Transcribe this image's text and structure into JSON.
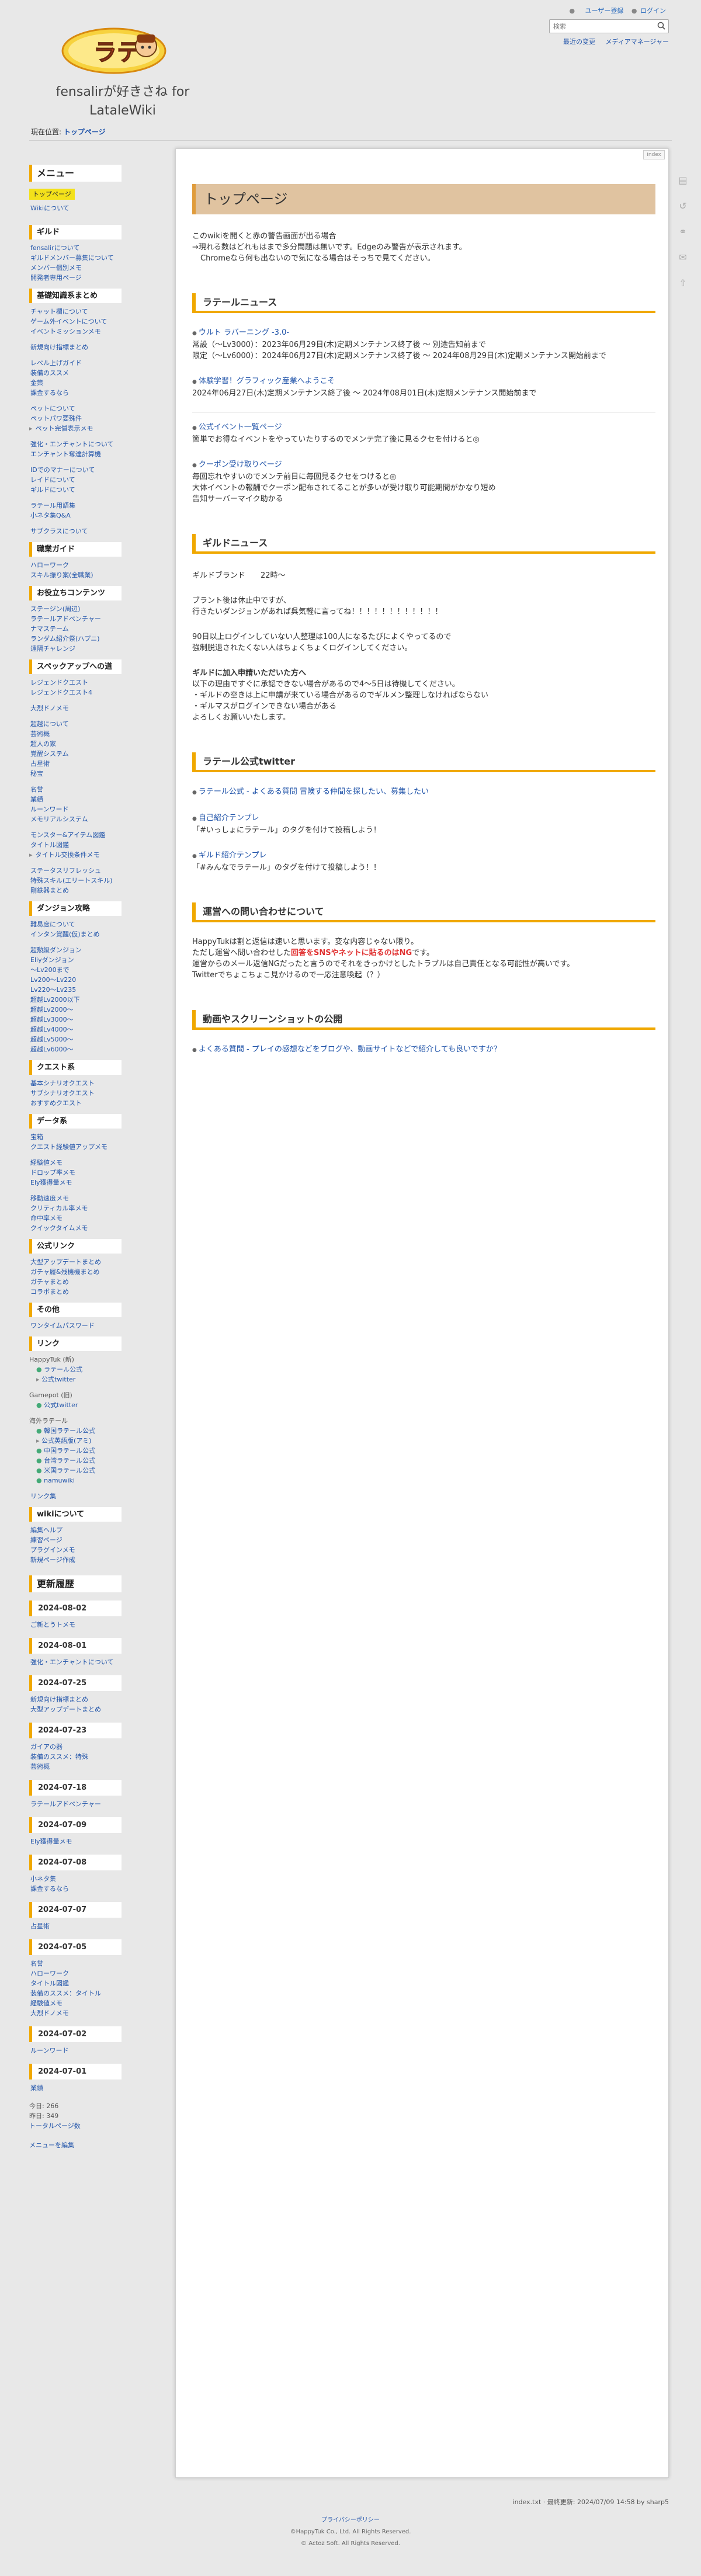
{
  "header": {
    "logo_text": "ラテール",
    "site_title": "fensalirが好きさね for LataleWiki",
    "user_links": [
      "ユーザー登録",
      "ログイン"
    ],
    "search_placeholder": "検索",
    "sub_links": [
      "最近の変更",
      "メディアマネージャー"
    ]
  },
  "breadcrumb": {
    "prefix": "現在位置:",
    "current": "トップページ"
  },
  "sidebar": {
    "menu_title": "メニュー",
    "menu_items": [
      "トップページ",
      "Wikiについて"
    ],
    "guild_title": "ギルド",
    "guild_items": [
      "fensalirについて",
      "ギルドメンバー募集について",
      "メンバー個別メモ",
      "開発者専用ページ"
    ],
    "basic_title": "基礎知識系まとめ",
    "basic_items_1": [
      "チャット欄について",
      "ゲーム外イベントについて",
      "イベントミッションメモ"
    ],
    "basic_items_2": [
      "新規向け指標まとめ"
    ],
    "basic_items_3": [
      "レベル上げガイド",
      "装備のススメ",
      "金策",
      "課金するなら"
    ],
    "basic_items_4": [
      "ペットについて",
      "ペットパワ要殊件",
      "ペット完償表示メモ"
    ],
    "basic_items_5": [
      "強化・エンチャントについて",
      "エンチャント奪達計算機"
    ],
    "basic_items_6": [
      "IDでのマナーについて",
      "レイドについて",
      "ギルドについて"
    ],
    "basic_items_7": [
      "ラテール用語集",
      "小ネタ集Q&A"
    ],
    "basic_items_8": [
      "サブクラスについて"
    ],
    "job_title": "職業ガイド",
    "job_items": [
      "ハローワーク",
      "スキル振り案(全職業)"
    ],
    "useful_title": "お役立ちコンテンツ",
    "useful_items": [
      "ステージン(周辺)",
      "ラテールアドベンチャー",
      "ナマステーム",
      "ランダム紹介祭(ハプニ)",
      "遠隔チャレンジ"
    ],
    "spec_title": "スペックアップへの道",
    "spec_items_1": [
      "レジェンドクエスト",
      "レジェンドクエスト4"
    ],
    "spec_items_2": [
      "大烈ドノメモ"
    ],
    "spec_items_3": [
      "超越について",
      "芸術概",
      "超人の家",
      "覚醒システム",
      "占星術",
      "秘宝"
    ],
    "spec_items_4": [
      "名誉",
      "業績",
      "ルーンワード",
      "メモリアルシステム"
    ],
    "spec_items_5": [
      "モンスター&アイテム図鑑",
      "タイトル図鑑",
      "タイトル交換条件メモ"
    ],
    "spec_items_6": [
      "ステータスリフレッシュ",
      "特殊スキル(エリートスキル)",
      "剛鉄器まとめ"
    ],
    "dungeon_title": "ダンジョン攻略",
    "dungeon_items_1": [
      "難易度について",
      "インタン覚醒(仮)まとめ"
    ],
    "dungeon_items_2": [
      "超勲級ダンジョン",
      "Eliyダンジョン",
      "〜Lv200まで",
      "Lv200〜Lv220",
      "Lv220〜Lv235",
      "超越Lv2000以下",
      "超越Lv2000〜",
      "超越Lv3000〜",
      "超越Lv4000〜",
      "超越Lv5000〜",
      "超越Lv6000〜"
    ],
    "quest_title": "クエスト系",
    "quest_items": [
      "基本シナリオクエスト",
      "サブシナリオクエスト",
      "おすすめクエスト"
    ],
    "data_title": "データ系",
    "data_items_1": [
      "宝箱",
      "クエスト経験値アップメモ"
    ],
    "data_items_2": [
      "経験値メモ",
      "ドロップ率メモ",
      "Ely獲得量メモ"
    ],
    "data_items_3": [
      "移動速度メモ",
      "クリティカル率メモ",
      "命中率メモ",
      "クイックタイムメモ"
    ],
    "official_title": "公式リンク",
    "official_items": [
      "大型アップデートまとめ",
      "ガチャ履&残機機まとめ",
      "ガチャまとめ",
      "コラボまとめ"
    ],
    "other_title": "その他",
    "other_items": [
      "ワンタイムパスワード"
    ],
    "links_title": "リンク",
    "link_group1": "HappyTuk (新)",
    "link_group1_items": [
      "ラテール公式",
      "公式twitter"
    ],
    "link_group2": "Gamepot (旧)",
    "link_group2_items": [
      "公式twitter"
    ],
    "link_group3": "海外ラテール",
    "link_group3_items": [
      "韓国ラテール公式",
      "公式英語版(アミ)",
      "中国ラテール公式",
      "台湾ラテール公式",
      "米国ラテール公式",
      "namuwiki"
    ],
    "link_extra": [
      "リンク集"
    ],
    "wiki_title": "wikiについて",
    "wiki_items": [
      "編集ヘルプ",
      "練習ページ",
      "プラグインメモ",
      "新規ページ作成"
    ],
    "updates_title": "更新履歴",
    "updates": [
      {
        "date": "2024-08-02",
        "items": [
          "ご新とうトメモ"
        ]
      },
      {
        "date": "2024-08-01",
        "items": [
          "強化・エンチャントについて"
        ]
      },
      {
        "date": "2024-07-25",
        "items": [
          "新規向け指標まとめ",
          "大型アップデートまとめ"
        ]
      },
      {
        "date": "2024-07-23",
        "items": [
          "ガイアの器",
          "装備のススメ：特殊",
          "芸術概"
        ]
      },
      {
        "date": "2024-07-18",
        "items": [
          "ラテールアドベンチャー"
        ]
      },
      {
        "date": "2024-07-09",
        "items": [
          "Ely獲得量メモ"
        ]
      },
      {
        "date": "2024-07-08",
        "items": [
          "小ネタ集",
          "課金するなら"
        ]
      },
      {
        "date": "2024-07-07",
        "items": [
          "占星術"
        ]
      },
      {
        "date": "2024-07-05",
        "items": [
          "名誉",
          "ハローワーク",
          "タイトル図鑑",
          "装備のススメ：タイトル",
          "経験値メモ",
          "大烈ドノメモ"
        ]
      },
      {
        "date": "2024-07-02",
        "items": [
          "ルーンワード"
        ]
      },
      {
        "date": "2024-07-01",
        "items": [
          "業績"
        ]
      }
    ],
    "counter_today": "今日: 266",
    "counter_yesterday": "昨日: 349",
    "counter_total": "トータルページ数",
    "edit_menu": "メニューを編集"
  },
  "main": {
    "index_tag": "index",
    "title": "トップページ",
    "intro": [
      "このwikiを開くと赤の警告画面が出る場合",
      "→現れる数はどれもはまで多分問題は無いです。Edgeのみ警告が表示されます。",
      "Chromeなら何も出ないので気になる場合はそっちで見てください。"
    ],
    "news_title": "ラテールニュース",
    "news_1_link": "ウルト ラバーニング -3.0-",
    "news_1_lines": [
      "常設（〜Lv3000）：2023年06月29日(木)定期メンテナンス終了後 〜 別途告知前まで",
      "限定（〜Lv6000）：2024年06月27日(木)定期メンテナンス終了後 〜 2024年08月29日(木)定期メンテナンス開始前まで"
    ],
    "news_2_link": "体験学習！グラフィック産業へようこそ",
    "news_2_lines": [
      "2024年06月27日(木)定期メンテナンス終了後 〜 2024年08月01日(木)定期メンテナンス開始前まで"
    ],
    "news_3_link": "公式イベント一覧ページ",
    "news_3_lines": [
      "簡単でお得なイベントをやっていたりするのでメンテ完了後に見るクセを付けると◎"
    ],
    "news_4_link": "クーポン受け取りページ",
    "news_4_lines": [
      "毎回忘れやすいのでメンテ前日に毎回見るクセをつけると◎",
      "大体イベントの報酬でクーポン配布されてることが多いが受け取り可能期間がかなり短め",
      "告知サーバーマイク助かる"
    ],
    "guild_title": "ギルドニュース",
    "guild_lines_1": [
      "ギルドブランド　　22時〜"
    ],
    "guild_lines_2": [
      "ブラント後は休止中ですが、",
      "行きたいダンジョンがあれば呉気軽に言ってね！！！！！！！！！！！！"
    ],
    "guild_lines_3": [
      "90日以上ログインしていない人整理は100人になるたびによくやってるので",
      "強制脱退されたくない人はちょくちょくログインしてください。"
    ],
    "guild_join_title": "ギルドに加入申請いただいた方へ",
    "guild_join_lines": [
      "以下の理由ですぐに承認できない場合があるので4〜5日は待機してください。",
      "・ギルドの空きは上に申請が来ている場合があるのでギルメン整理しなければならない",
      "・ギルマスがログインできない場合がある",
      "よろしくお願いいたします。"
    ],
    "twitter_title": "ラテール公式twitter",
    "twitter_1_link": "ラテール公式 - よくある質問 冒険する仲間を探したい、募集したい",
    "twitter_2_link": "自己紹介テンプレ",
    "twitter_2_text": "「#いっしょにラテール」のタグを付けて投稿しよう！",
    "twitter_3_link": "ギルド紹介テンプレ",
    "twitter_3_text": "「#みんなでラテール」のタグを付けて投稿しよう！！",
    "contact_title": "運営への問い合わせについて",
    "contact_line_1": "HappyTukは割と返信は速いと思います。変な内容じゃない限り。",
    "contact_line_2_pre": "ただし運営へ問い合わせした",
    "contact_line_2_red": "回答をSNSやネットに貼るのはNG",
    "contact_line_2_post": "です。",
    "contact_line_3": "運営からのメール返信NGだったと言うのでそれをきっかけとしたトラブルは自己責任となる可能性が高いです。",
    "contact_line_4": "Twitterでちょこちょこ見かけるので一応注意喚起（？）",
    "video_title": "動画やスクリーンショットの公開",
    "video_link": "よくある質問 - プレイの感想などをブログや、動画サイトなどで紹介しても良いですか？"
  },
  "footer": {
    "meta": "index.txt · 最終更新: 2024/07/09 14:58 by sharp5",
    "privacy": "プライバシーポリシー",
    "copy1": "©HappyTuk Co., Ltd. All Rights Reserved.",
    "copy2": "© Actoz Soft. All Rights Reserved."
  },
  "colors": {
    "accent": "#f0a800",
    "title_bg": "#e0c3a0",
    "link": "#2255aa"
  }
}
